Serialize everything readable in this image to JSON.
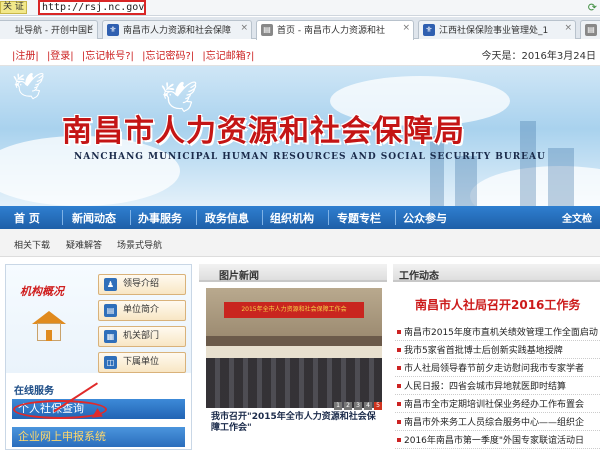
{
  "browser": {
    "cert_label": "关 证",
    "url": "http://rsj.nc.gov.cn/",
    "tabs": [
      {
        "label": "址导航 - 开创中国E",
        "active": false
      },
      {
        "label": "南昌市人力资源和社会保障",
        "active": false
      },
      {
        "label": "首页 - 南昌市人力资源和社",
        "active": true
      },
      {
        "label": "江西社保保险事业管理处_1",
        "active": false
      },
      {
        "label": "都",
        "active": false
      }
    ]
  },
  "utility": {
    "links": [
      "|注册|",
      "|登录|",
      "|忘记帐号?|",
      "|忘记密码?|",
      "|忘记邮箱?|"
    ],
    "date": "今天是：2016年3月24日"
  },
  "banner": {
    "title": "南昌市人力资源和社会保障局",
    "subtitle": "NANCHANG MUNICIPAL HUMAN RESOURCES AND SOCIAL SECURITY BUREAU"
  },
  "nav": {
    "items": [
      "首 页",
      "新闻动态",
      "办事服务",
      "政务信息",
      "组织机构",
      "专题专栏",
      "公众参与",
      "全文检"
    ],
    "sub_items": [
      "相关下载",
      "疑难解答",
      "场景式导航"
    ]
  },
  "left": {
    "section_title": "机构概况",
    "buttons": [
      "领导介绍",
      "单位简介",
      "机关部门",
      "下属单位"
    ],
    "online_title": "在线服务",
    "services": [
      "个人社保查询",
      "企业网上申报系统"
    ]
  },
  "center": {
    "title": "图片新闻",
    "photo_banner": "2015年全市人力资源和社会保障工作会",
    "pages": [
      "1",
      "2",
      "3",
      "4",
      "5"
    ],
    "active_page": 5,
    "caption": "我市召开\"2015年全市人力资源和社会保障工作会\""
  },
  "right": {
    "title": "工作动态",
    "headline": "南昌市人社局召开2016工作务",
    "news": [
      "南昌市2015年度市直机关绩效管理工作全面启动",
      "我市5家省首批博士后创新实践基地授牌",
      "市人社局领导春节前夕走访慰问我市专家学者",
      "人民日报：四省会城市异地就医即时结算",
      "南昌市全市定期培训社保业务经办工作布置会",
      "南昌市外来务工人员综合服务中心——组织企",
      "2016年南昌市第一季度\"外国专家联谊活动日"
    ]
  }
}
